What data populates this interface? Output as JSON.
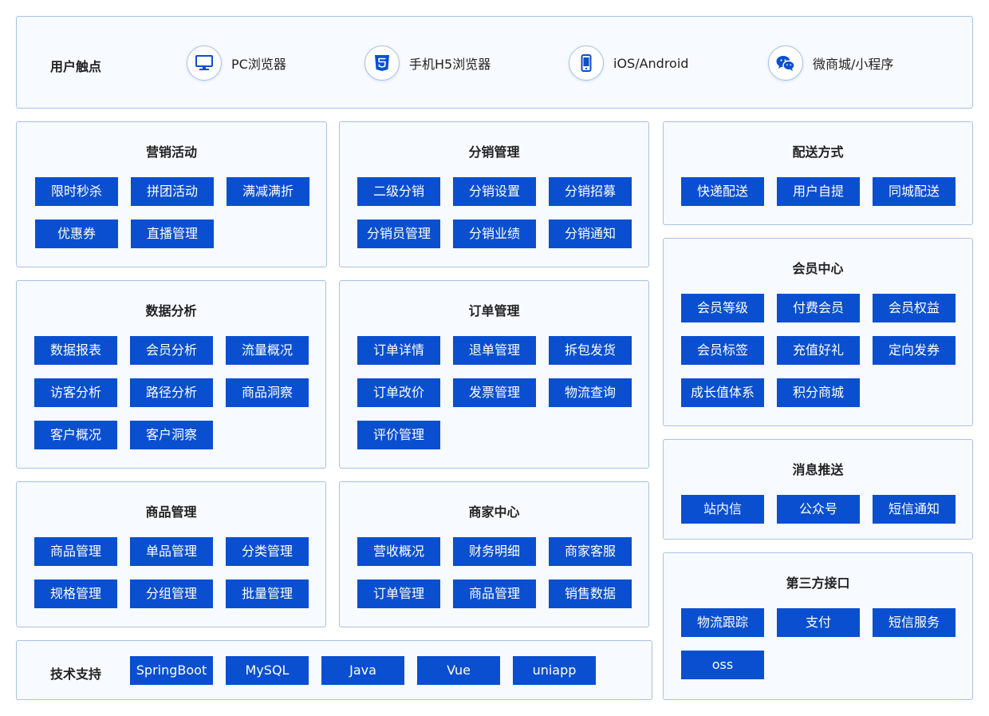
{
  "touchpoints": {
    "label": "用户触点",
    "items": [
      {
        "label": "PC浏览器",
        "icon": "monitor-icon"
      },
      {
        "label": "手机H5浏览器",
        "icon": "html5-icon"
      },
      {
        "label": "iOS/Android",
        "icon": "smartphone-icon"
      },
      {
        "label": "微商城/小程序",
        "icon": "wechat-icon"
      }
    ]
  },
  "modules": {
    "marketing": {
      "title": "营销活动",
      "items": [
        "限时秒杀",
        "拼团活动",
        "满减满折",
        "优惠券",
        "直播管理"
      ]
    },
    "distribution": {
      "title": "分销管理",
      "items": [
        "二级分销",
        "分销设置",
        "分销招募",
        "分销员管理",
        "分销业绩",
        "分销通知"
      ]
    },
    "delivery": {
      "title": "配送方式",
      "items": [
        "快递配送",
        "用户自提",
        "同城配送"
      ]
    },
    "analytics": {
      "title": "数据分析",
      "items": [
        "数据报表",
        "会员分析",
        "流量概况",
        "访客分析",
        "路径分析",
        "商品洞察",
        "客户概况",
        "客户洞察"
      ]
    },
    "orders": {
      "title": "订单管理",
      "items": [
        "订单详情",
        "退单管理",
        "拆包发货",
        "订单改价",
        "发票管理",
        "物流查询",
        "评价管理"
      ]
    },
    "members": {
      "title": "会员中心",
      "items": [
        "会员等级",
        "付费会员",
        "会员权益",
        "会员标签",
        "充值好礼",
        "定向发券",
        "成长值体系",
        "积分商城"
      ]
    },
    "messages": {
      "title": "消息推送",
      "items": [
        "站内信",
        "公众号",
        "短信通知"
      ]
    },
    "products": {
      "title": "商品管理",
      "items": [
        "商品管理",
        "单品管理",
        "分类管理",
        "规格管理",
        "分组管理",
        "批量管理"
      ]
    },
    "merchant": {
      "title": "商家中心",
      "items": [
        "营收概况",
        "财务明细",
        "商家客服",
        "订单管理",
        "商品管理",
        "销售数据"
      ]
    },
    "thirdparty": {
      "title": "第三方接口",
      "items": [
        "物流跟踪",
        "支付",
        "短信服务",
        "oss"
      ]
    }
  },
  "tech": {
    "label": "技术支持",
    "items": [
      "SpringBoot",
      "MySQL",
      "Java",
      "Vue",
      "uniapp"
    ]
  },
  "colors": {
    "accent": "#0a4fd0",
    "panel_border": "#a9c2e6",
    "panel_bg": "#f7fafe"
  }
}
